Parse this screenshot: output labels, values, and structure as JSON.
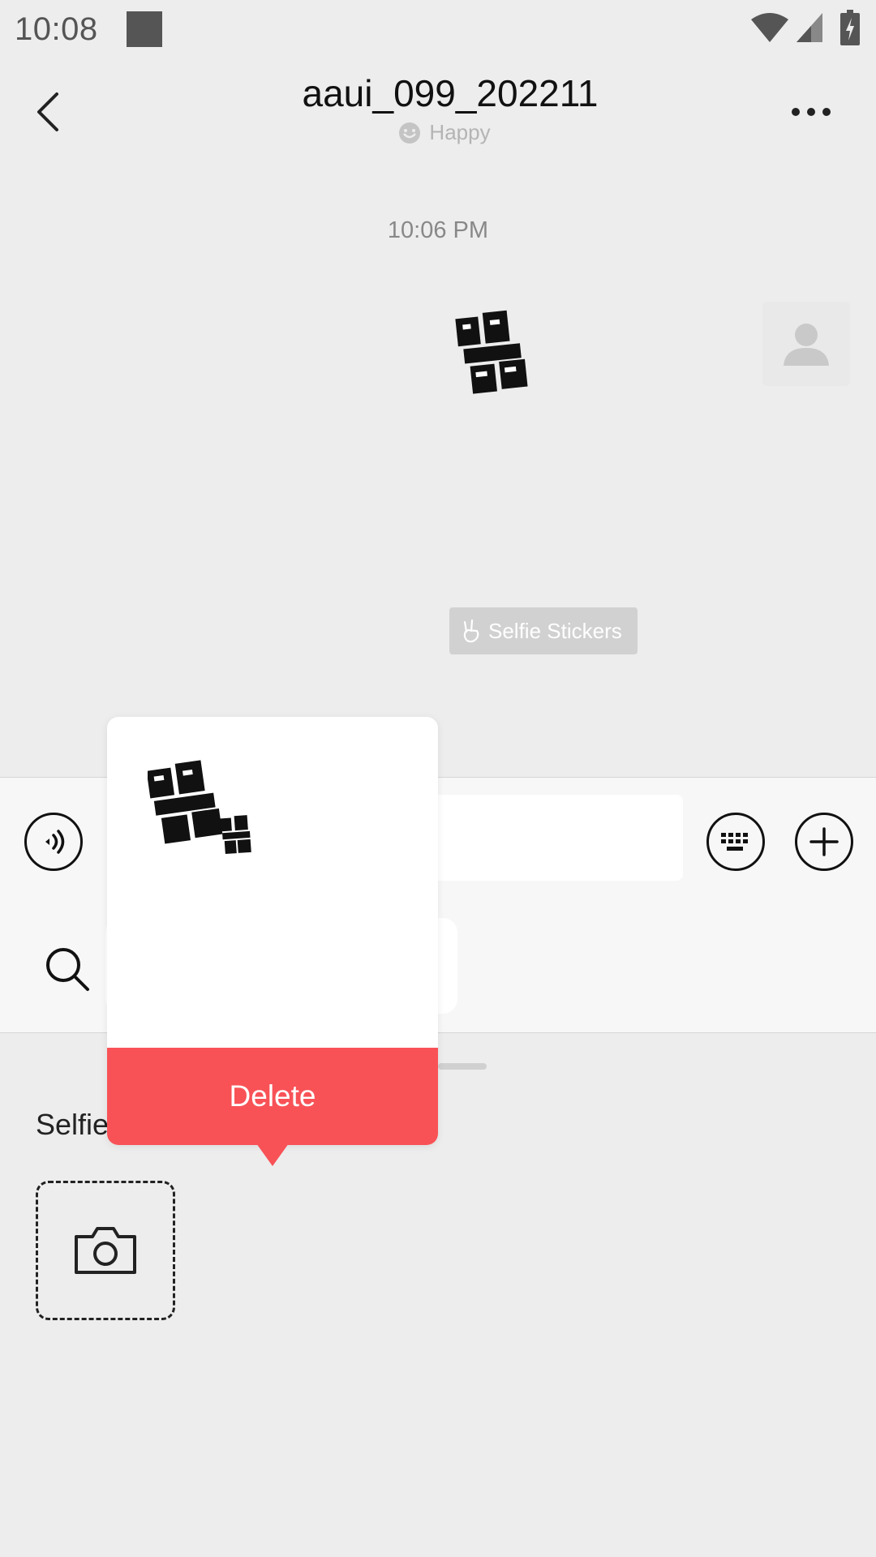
{
  "status_bar": {
    "time": "10:08"
  },
  "header": {
    "title": "aaui_099_202211",
    "status": "Happy",
    "back_icon": "chevron-left-icon",
    "more_icon": "more-horizontal-icon"
  },
  "chat": {
    "timestamp": "10:06 PM",
    "selfie_chip_label": "Selfie Stickers"
  },
  "input_bar": {
    "voice_icon": "voice-icon",
    "keyboard_icon": "keyboard-icon",
    "plus_icon": "plus-icon",
    "search_icon": "search-icon"
  },
  "sticker_panel": {
    "section_label": "Selfie"
  },
  "popup": {
    "delete_label": "Delete"
  },
  "colors": {
    "delete_red": "#f85257",
    "background": "#ededed"
  }
}
